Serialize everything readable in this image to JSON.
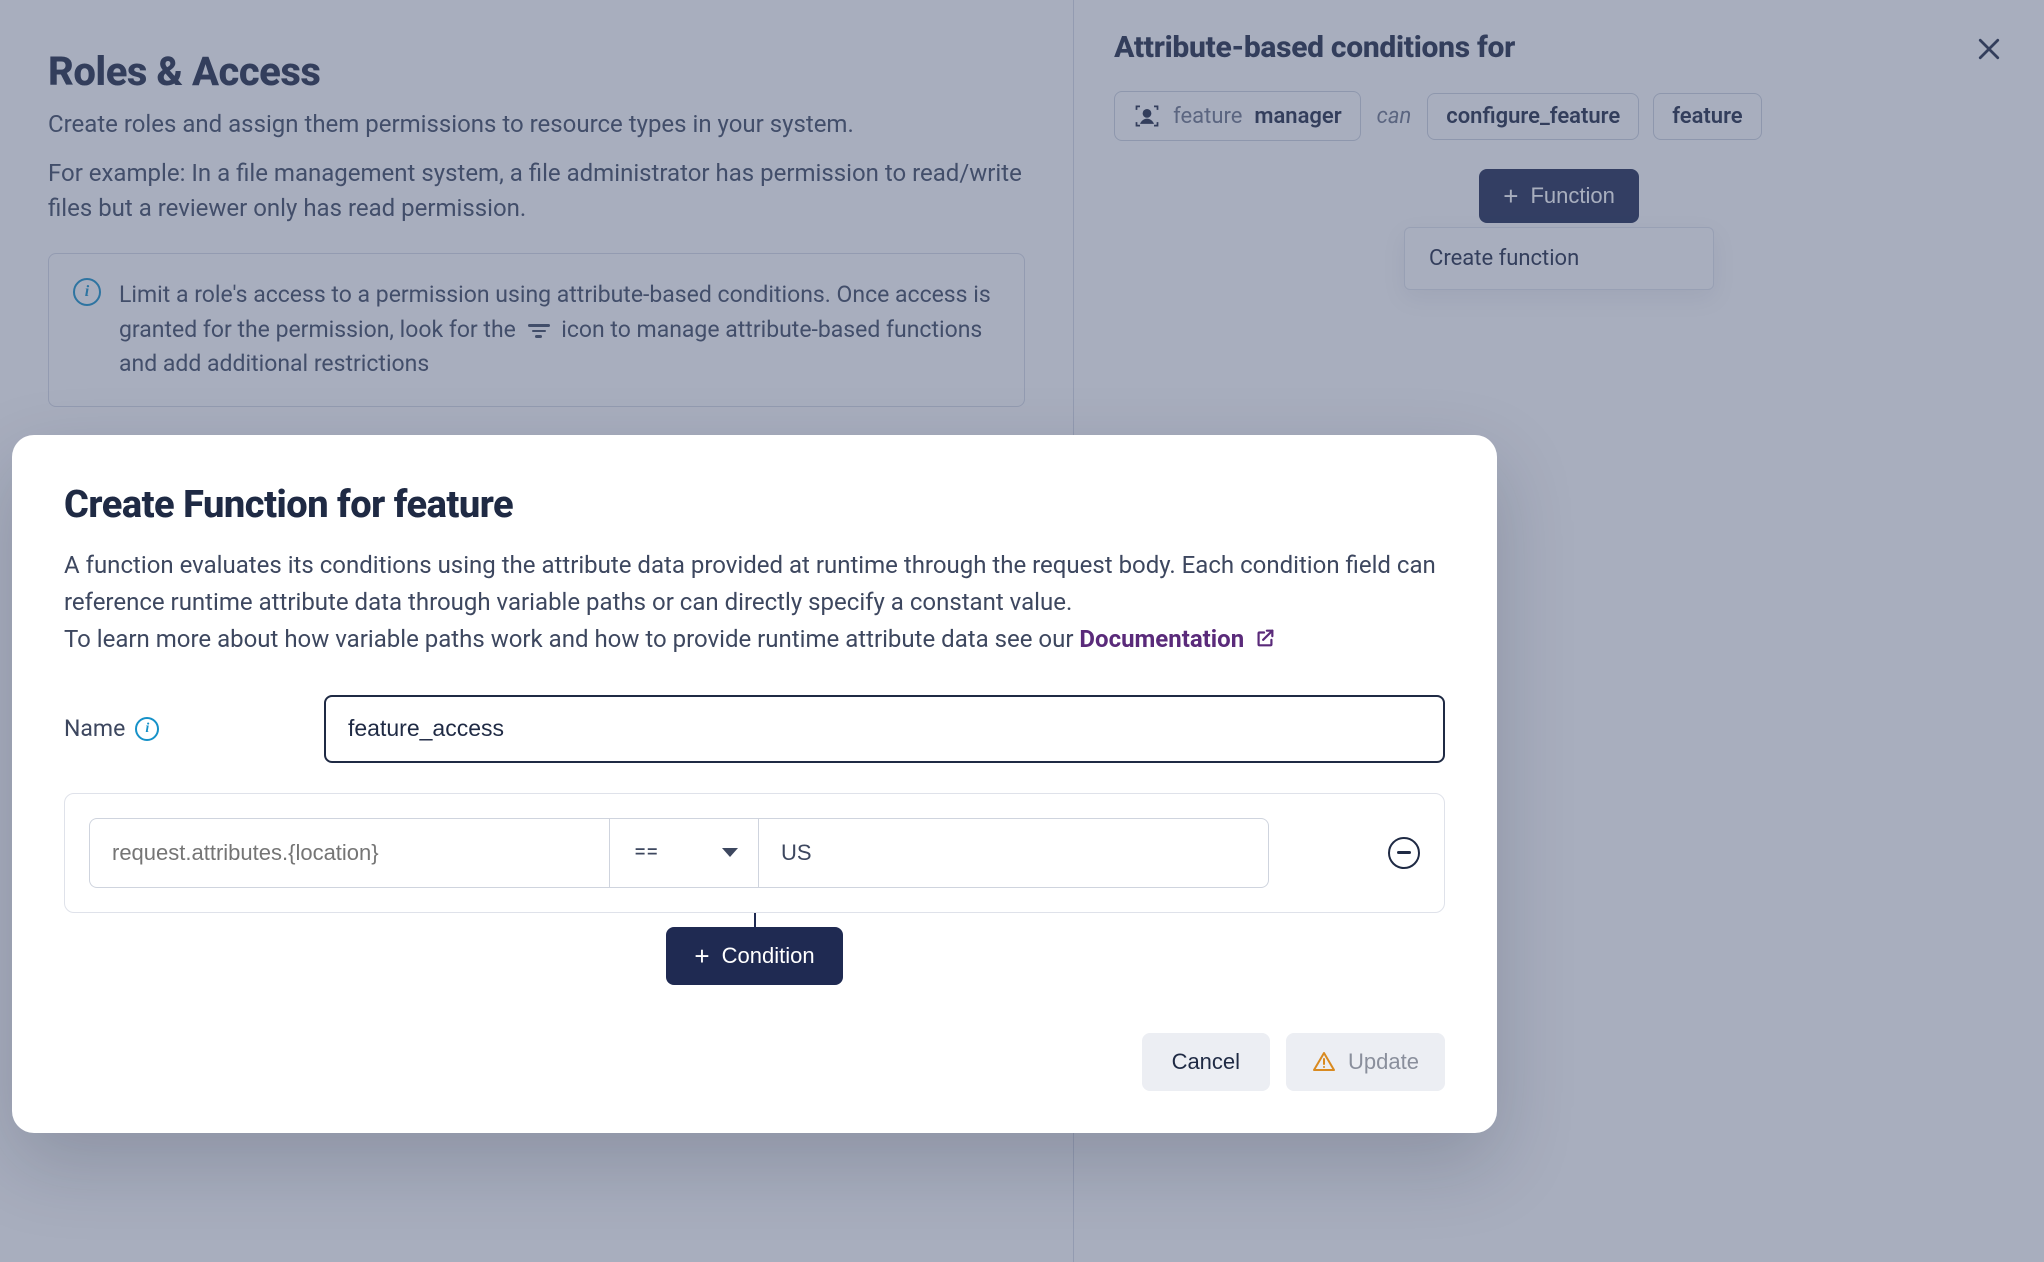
{
  "left": {
    "title": "Roles & Access",
    "sub1": "Create roles and assign them permissions to resource types in your system.",
    "sub2": "For example: In a file management system, a file administrator has permission to read/write files but a reviewer only has read permission.",
    "info_pre": "Limit a role's access to a permission using attribute-based conditions. Once access is granted for the permission, look for the",
    "info_post": "icon to manage attribute-based functions and add additional restrictions"
  },
  "right": {
    "title": "Attribute-based conditions for",
    "role_label": "feature",
    "role_value": "manager",
    "can_word": "can",
    "permission": "configure_feature",
    "resource": "feature",
    "function_btn": "Function",
    "create_fn": "Create function"
  },
  "modal": {
    "title": "Create Function for feature",
    "desc1": "A function evaluates its conditions using the attribute data provided at runtime through the request body. Each condition field can reference runtime attribute data through variable paths or can directly specify a constant value.",
    "desc2_pre": "To learn more about how variable paths work and how to provide runtime attribute data see our ",
    "doc_link": "Documentation",
    "name_label": "Name",
    "name_value": "feature_access",
    "cond_left_placeholder": "request.attributes.{location}",
    "cond_op": "==",
    "cond_right_value": "US",
    "add_condition": "Condition",
    "cancel": "Cancel",
    "update": "Update"
  }
}
